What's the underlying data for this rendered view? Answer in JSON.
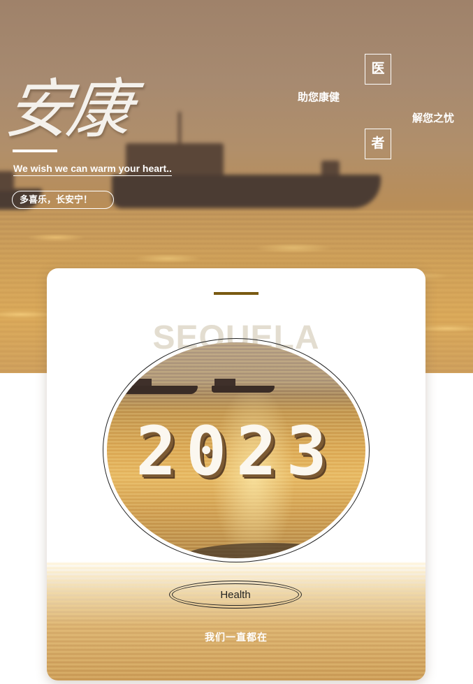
{
  "hero": {
    "calligraphy": "安康",
    "tagline": "We wish we can warm your heart..",
    "pill_button": "多喜乐，长安宁！",
    "char_top": "医",
    "char_bottom": "者",
    "phrase_left": "助您康健",
    "phrase_right": "解您之忧"
  },
  "card": {
    "watermark": "SEQUELA",
    "year": "2023",
    "button_label": "Health",
    "footer_text": "我们一直都在"
  },
  "colors": {
    "accent": "#7a5a12",
    "hero_tone": "#a78a70",
    "gold": "#d6a456"
  }
}
